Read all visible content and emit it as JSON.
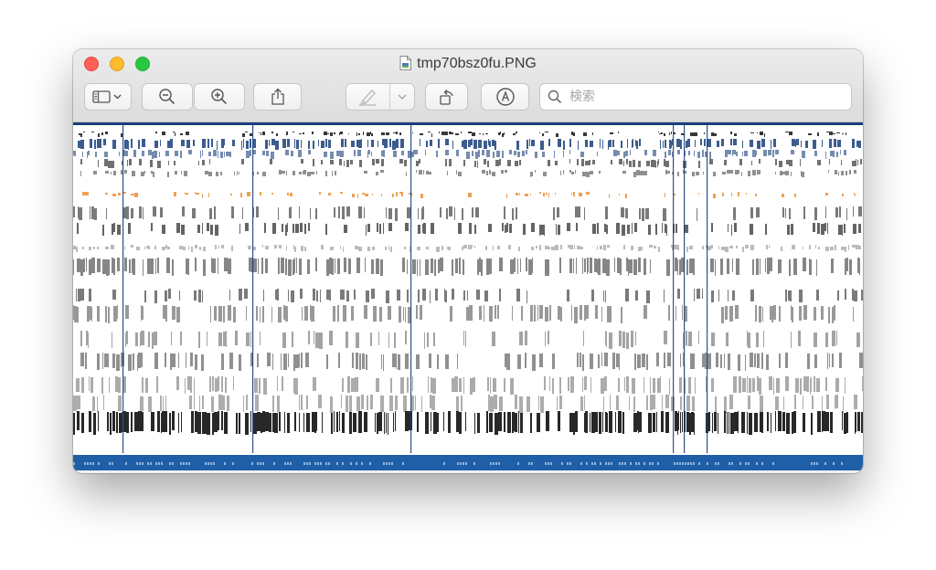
{
  "window": {
    "title": "tmp70bsz0fu.PNG"
  },
  "toolbar": {
    "sidebar_button": "sidebar-toggle",
    "zoom_out": "zoom-out",
    "zoom_in": "zoom-in",
    "share": "share",
    "markup_pen": "highlight-pen",
    "rotate": "rotate",
    "markup": "markup"
  },
  "search": {
    "placeholder": "検索"
  },
  "colors": {
    "accent_blue": "#1f5fa8",
    "dark_blue": "#1a3f7a",
    "orange": "#e8892b"
  }
}
